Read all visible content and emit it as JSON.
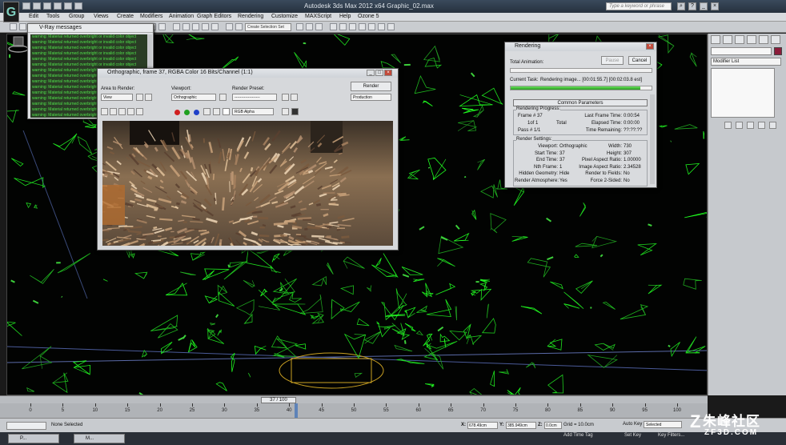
{
  "app": {
    "title": "Autodesk 3ds Max 2012 x64   Graphic_02.max",
    "logo": "G",
    "search_placeholder": "Type a keyword or phrase"
  },
  "menu": [
    "Edit",
    "Tools",
    "Group",
    "Views",
    "Create",
    "Modifiers",
    "Animation",
    "Graph Editors",
    "Rendering",
    "Customize",
    "MAXScript",
    "Help",
    "Ozone 5"
  ],
  "toolbar": {
    "selection_set": "Create Selection Set"
  },
  "vray_messages": {
    "title": "V-Ray messages",
    "line": "warning: Material returned overbright or invalid color object",
    "count": 15
  },
  "frame_buffer": {
    "title": "Orthographic, frame 37, RGBA Color 16 Bits/Channel (1:1)",
    "area_label": "Area to Render:",
    "area_value": "View",
    "viewport_label": "Viewport:",
    "viewport_value": "Orthographic",
    "preset_label": "Render Preset:",
    "preset_value": "-------------------",
    "render_button": "Render",
    "production_value": "Production",
    "channel_value": "RGB Alpha",
    "channel_colors": [
      "#d02020",
      "#20a020",
      "#2040c8"
    ]
  },
  "rendering": {
    "title": "Rendering",
    "total_animation": "Total Animation:",
    "pause_button": "Pause",
    "cancel_button": "Cancel",
    "current_task_label": "Current Task:",
    "current_task_value": "Rendering image... [00:01:55.7] [00:02:03.8 est]",
    "progress_total": 0.0,
    "progress_current": 0.92,
    "common_params": "Common Parameters",
    "progress_group": "Rendering Progress:",
    "frame_label": "Frame #",
    "frame_value": "37",
    "last_frame_time_label": "Last Frame Time:",
    "last_frame_time_value": "0:00:54",
    "of_label": "1of 1",
    "total_label": "Total",
    "elapsed_label": "Elapsed Time:",
    "elapsed_value": "0:00:00",
    "pass_label": "Pass #",
    "pass_value": "1/1",
    "remaining_label": "Time Remaining:",
    "remaining_value": "??:??:??",
    "settings_group": "Render Settings:",
    "settings_left": [
      [
        "Viewport:",
        "Orthographic"
      ],
      [
        "Start Time:",
        "37"
      ],
      [
        "End Time:",
        "37"
      ],
      [
        "Nth Frame:",
        "1"
      ],
      [
        "Hidden Geometry:",
        "Hide"
      ],
      [
        "Render Atmosphere:",
        "Yes"
      ]
    ],
    "settings_right": [
      [
        "Width:",
        "730"
      ],
      [
        "Height:",
        "307"
      ],
      [
        "Pixel Aspect Ratio:",
        "1.00000"
      ],
      [
        "Image Aspect Ratio:",
        "2.34528"
      ],
      [
        "Render to Fields:",
        "No"
      ],
      [
        "Force 2-Sided:",
        "No"
      ]
    ]
  },
  "command_panel": {
    "modifier_list": "Modifier List",
    "color": "#8b1c3a"
  },
  "timeline": {
    "frame_indicator": "37 / 100",
    "current_frame": 37,
    "ticks": [
      0,
      5,
      10,
      15,
      20,
      25,
      30,
      35,
      40,
      45,
      50,
      55,
      60,
      65,
      70,
      75,
      80,
      85,
      90,
      95,
      100
    ]
  },
  "status": {
    "selection": "None Selected",
    "x_value": "678.49cm",
    "y_value": "385.949cm",
    "z_value": "0.0cm",
    "grid": "Grid = 10.0cm",
    "auto_key": "Auto Key",
    "selected": "Selected",
    "set_key": "Set Key",
    "key_filters": "Key Filters...",
    "add_time_tag": "Add Time Tag"
  },
  "taskbar": [
    "P...",
    "M..."
  ],
  "watermark": {
    "main": "朱峰社区",
    "sub": "ZF3D.COM"
  }
}
